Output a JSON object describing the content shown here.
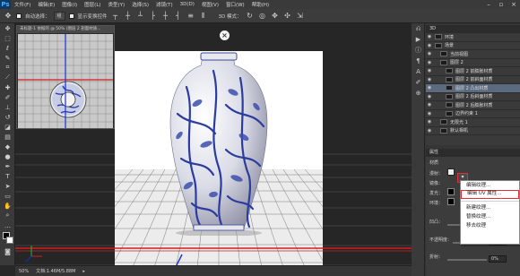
{
  "app": {
    "logo": "Ps"
  },
  "menu": [
    "文件(F)",
    "编辑(E)",
    "图像(I)",
    "图层(L)",
    "类型(Y)",
    "选择(S)",
    "滤镜(T)",
    "3D(D)",
    "视图(V)",
    "窗口(W)",
    "帮助(H)"
  ],
  "options_bar": {
    "auto_select_label": "自动选择：",
    "auto_select_value": "组",
    "show_transform": "显示变换控件",
    "mode_3d_label": "3D 模式："
  },
  "navigator": {
    "title": "未标题-1 依据的 @ 50% (图层 2 剖面材质..."
  },
  "status_bar": {
    "zoom": "50%",
    "doc_info": "文档:1.46M/5.88M"
  },
  "layers_panel": {
    "tab": "3D",
    "rows": [
      {
        "label": "环境",
        "indent": 0,
        "selected": false
      },
      {
        "label": "场景",
        "indent": 0,
        "selected": false
      },
      {
        "label": "当前视图",
        "indent": 1,
        "selected": false
      },
      {
        "label": "图层 2",
        "indent": 1,
        "selected": false
      },
      {
        "label": "图层 2 前膨胀材质",
        "indent": 2,
        "selected": false
      },
      {
        "label": "图层 2 前斜面材质",
        "indent": 2,
        "selected": false
      },
      {
        "label": "图层 2 凸出材质",
        "indent": 2,
        "selected": true
      },
      {
        "label": "图层 2 后斜面材质",
        "indent": 2,
        "selected": false
      },
      {
        "label": "图层 2 后膨胀材质",
        "indent": 2,
        "selected": false
      },
      {
        "label": "边界约束 1",
        "indent": 2,
        "selected": false
      },
      {
        "label": "无限光 1",
        "indent": 1,
        "selected": false
      },
      {
        "label": "默认相机",
        "indent": 1,
        "selected": false
      }
    ]
  },
  "properties_panel": {
    "tab": "属性",
    "section": "材质",
    "labels": [
      "漫射：",
      "镜像：",
      "发光：",
      "环境："
    ],
    "bump_label": "凹凸：",
    "opacity_label": "不透明度：",
    "refraction_label": "折射：",
    "values": [
      "0%",
      "0%",
      "0%"
    ]
  },
  "context_menu": {
    "items": [
      "编辑纹理...",
      "编辑 UV 属性...",
      "新建纹理...",
      "替换纹理...",
      "移去纹理"
    ],
    "highlighted_index": 1
  }
}
